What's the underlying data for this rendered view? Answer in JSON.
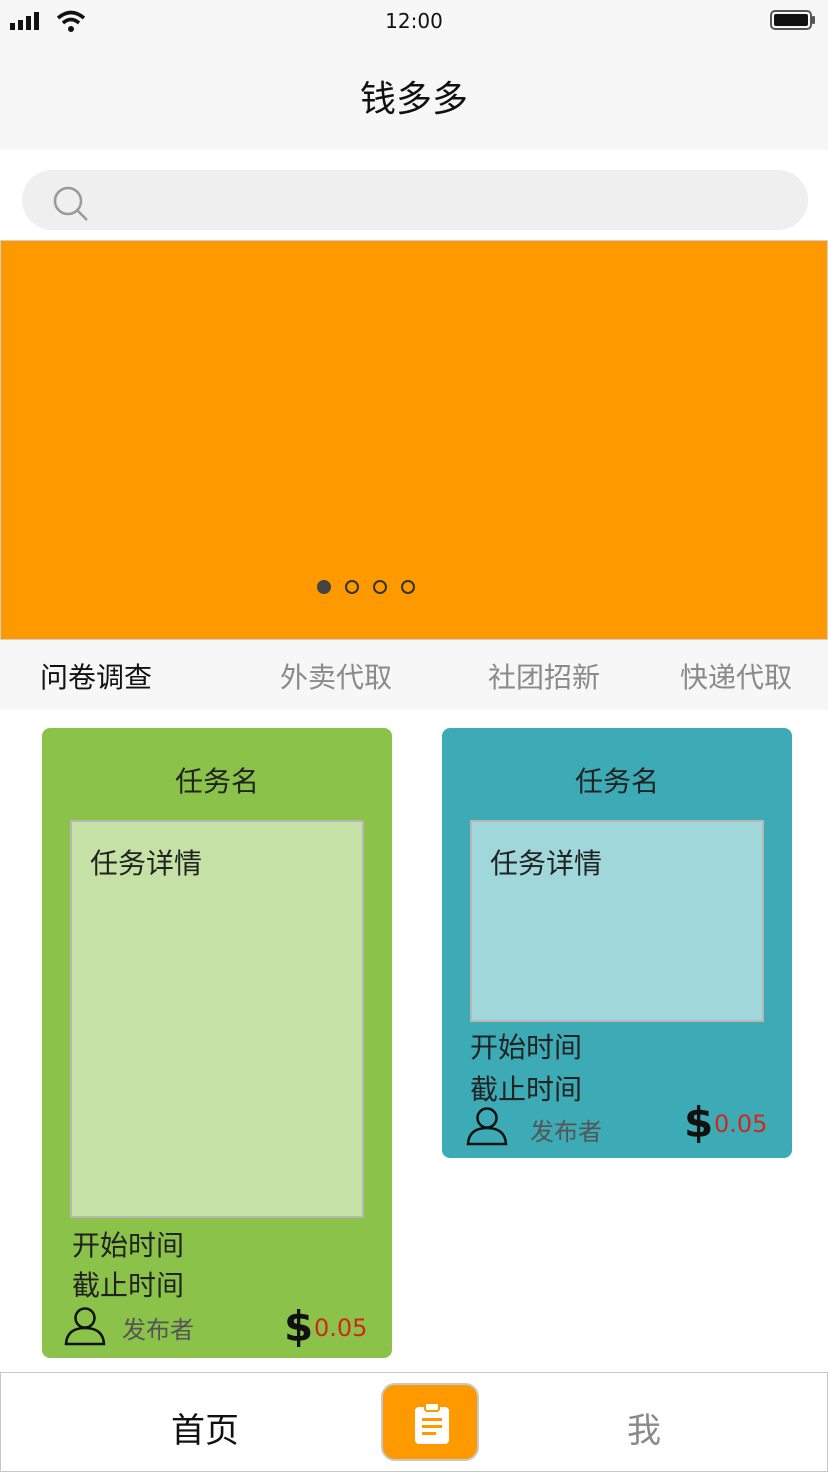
{
  "status": {
    "time": "12:00"
  },
  "navbar": {
    "title": "钱多多"
  },
  "search": {
    "placeholder": ""
  },
  "banner": {
    "color": "#ff9900",
    "slides": 4,
    "active_slide": 1
  },
  "categories": [
    {
      "label": "问卷调查",
      "active": true
    },
    {
      "label": "外卖代取",
      "active": false
    },
    {
      "label": "社团招新",
      "active": false
    },
    {
      "label": "快递代取",
      "active": false
    }
  ],
  "tasks": [
    {
      "title": "任务名",
      "detail": "任务详情",
      "start": "开始时间",
      "end": "截止时间",
      "publisher": "发布者",
      "price": "0.05",
      "color": "#8bc34a",
      "detail_bg": "#c5e1a5",
      "icon": "dollar-icon"
    },
    {
      "title": "任务名",
      "detail": "任务详情",
      "start": "开始时间",
      "end": "截止时间",
      "publisher": "发布者",
      "price": "0.05",
      "color": "#3dabb6",
      "detail_bg": "#a0d7db",
      "icon": "dollar-icon"
    }
  ],
  "tabbar": {
    "home": "首页",
    "me": "我",
    "center_icon": "clipboard-icon",
    "accent": "#ff9900"
  }
}
